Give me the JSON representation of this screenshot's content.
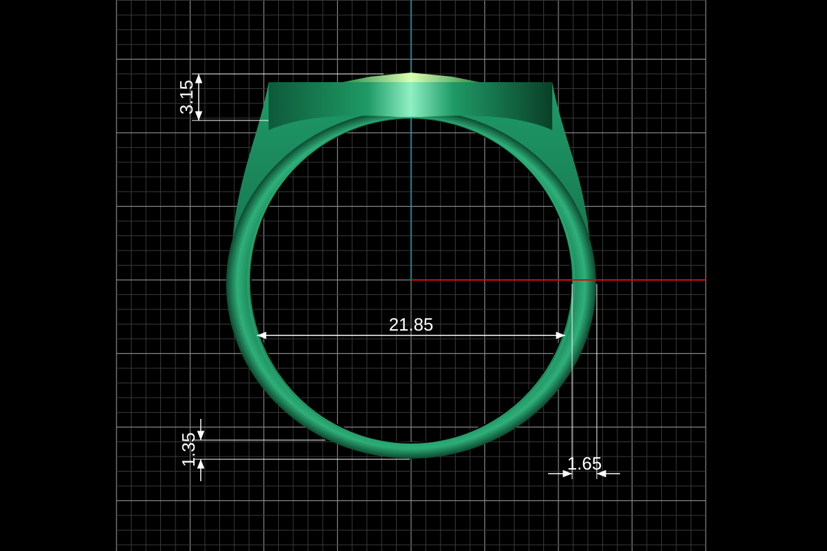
{
  "viewport": {
    "background": "#000000",
    "grid_minor_color": "#3a3a3a",
    "grid_major_color": "#8a8a8a",
    "axis_x_color": "#cc1111",
    "axis_y_color": "#1aa6b7"
  },
  "model": {
    "object": "signet ring",
    "color": "#1d8a5c",
    "view": "front"
  },
  "dimensions": {
    "inner_diameter": "21.85",
    "top_thickness": "3.15",
    "bottom_thickness": "1.35",
    "side_thickness": "1.65"
  }
}
